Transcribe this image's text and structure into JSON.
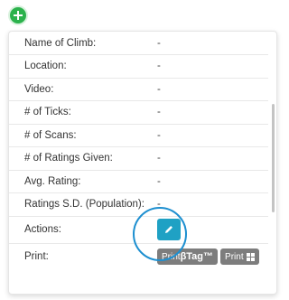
{
  "rows": [
    {
      "label": "Name of Climb:",
      "value": "-"
    },
    {
      "label": "Location:",
      "value": "-"
    },
    {
      "label": "Video:",
      "value": "-"
    },
    {
      "label": "# of Ticks:",
      "value": "-"
    },
    {
      "label": "# of Scans:",
      "value": "-"
    },
    {
      "label": "# of Ratings Given:",
      "value": "-"
    },
    {
      "label": "Avg. Rating:",
      "value": "-"
    },
    {
      "label": "Ratings S.D. (Population):",
      "value": "-"
    }
  ],
  "actions_label": "Actions:",
  "print_label": "Print:",
  "print_tag_prefix": "Print ",
  "print_tag_brand": "βTag™",
  "print_grid_label": "Print",
  "colors": {
    "add": "#2bb24c",
    "edit": "#1fa1c4",
    "print": "#7d7d7d",
    "highlight": "#1d8fd0"
  },
  "icons": {
    "add": "plus-icon",
    "edit": "pencil-icon",
    "grid": "grid-icon"
  }
}
